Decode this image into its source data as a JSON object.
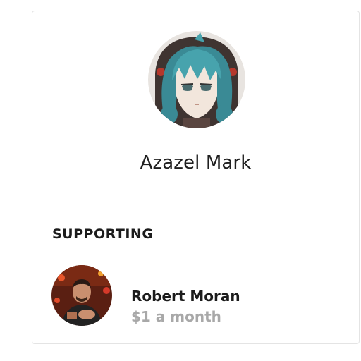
{
  "profile": {
    "name": "Azazel Mark",
    "avatar_icon": "anime-character-avatar"
  },
  "supporting": {
    "heading": "SUPPORTING",
    "items": [
      {
        "name": "Robert Moran",
        "price": "$1 a month",
        "avatar_icon": "person-photo-avatar"
      }
    ]
  },
  "colors": {
    "border": "#e4e4e4",
    "text": "#1c1c1c",
    "muted": "#a8a8a8"
  }
}
